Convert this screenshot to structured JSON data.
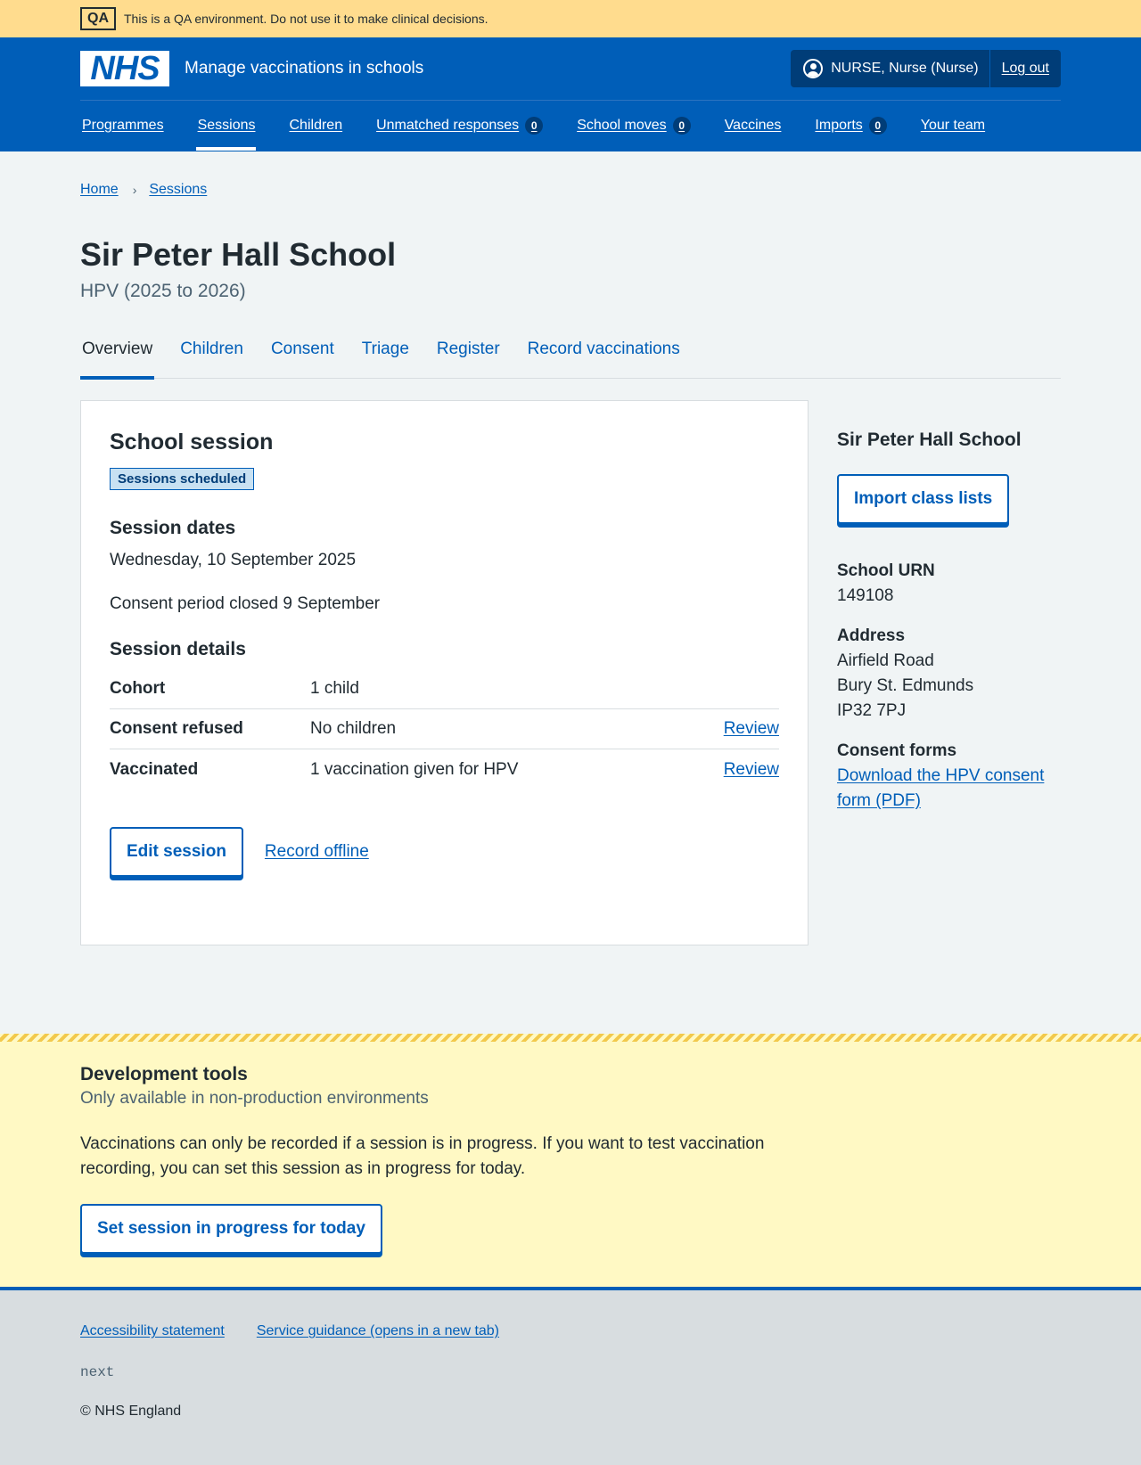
{
  "qa_banner": {
    "tag": "QA",
    "text": "This is a QA environment. Do not use it to make clinical decisions."
  },
  "header": {
    "logo_text": "NHS",
    "service_name": "Manage vaccinations in schools",
    "user_name": "NURSE, Nurse (Nurse)",
    "logout_label": "Log out",
    "nav": [
      {
        "label": "Programmes"
      },
      {
        "label": "Sessions",
        "active": true
      },
      {
        "label": "Children"
      },
      {
        "label": "Unmatched responses",
        "count": "0"
      },
      {
        "label": "School moves",
        "count": "0"
      },
      {
        "label": "Vaccines"
      },
      {
        "label": "Imports",
        "count": "0"
      },
      {
        "label": "Your team"
      }
    ]
  },
  "breadcrumb": [
    "Home",
    "Sessions"
  ],
  "page": {
    "title": "Sir Peter Hall School",
    "caption": "HPV (2025 to 2026)"
  },
  "tabs": [
    "Overview",
    "Children",
    "Consent",
    "Triage",
    "Register",
    "Record vaccinations"
  ],
  "card": {
    "title": "School session",
    "status_tag": "Sessions scheduled",
    "dates_heading": "Session dates",
    "date": "Wednesday, 10 September 2025",
    "consent_period": "Consent period closed 9 September",
    "details_heading": "Session details",
    "rows": [
      {
        "key": "Cohort",
        "value": "1 child",
        "action": ""
      },
      {
        "key": "Consent refused",
        "value": "No children",
        "action": "Review"
      },
      {
        "key": "Vaccinated",
        "value": "1 vaccination given for HPV",
        "action": "Review"
      }
    ],
    "edit_label": "Edit session",
    "offline_label": "Record offline"
  },
  "sidebar": {
    "title": "Sir Peter Hall School",
    "import_label": "Import class lists",
    "urn_label": "School URN",
    "urn": "149108",
    "address_label": "Address",
    "address": [
      "Airfield Road",
      "Bury St. Edmunds",
      "IP32 7PJ"
    ],
    "consent_label": "Consent forms",
    "consent_link": "Download the HPV consent form (PDF)"
  },
  "devtools": {
    "title": "Development tools",
    "subtitle": "Only available in non-production environments",
    "body": "Vaccinations can only be recorded if a session is in progress. If you want to test vaccination recording, you can set this session as in progress for today.",
    "button": "Set session in progress for today"
  },
  "footer": {
    "links": [
      "Accessibility statement",
      "Service guidance (opens in a new tab)"
    ],
    "version": "next",
    "copyright": "© NHS England"
  },
  "colors": {
    "brand_blue": "#005eb8",
    "dark_blue": "#003d78",
    "qa_yellow": "#ffdc8e",
    "devtools_bg": "#fff9c4",
    "page_bg": "#f0f4f5"
  }
}
